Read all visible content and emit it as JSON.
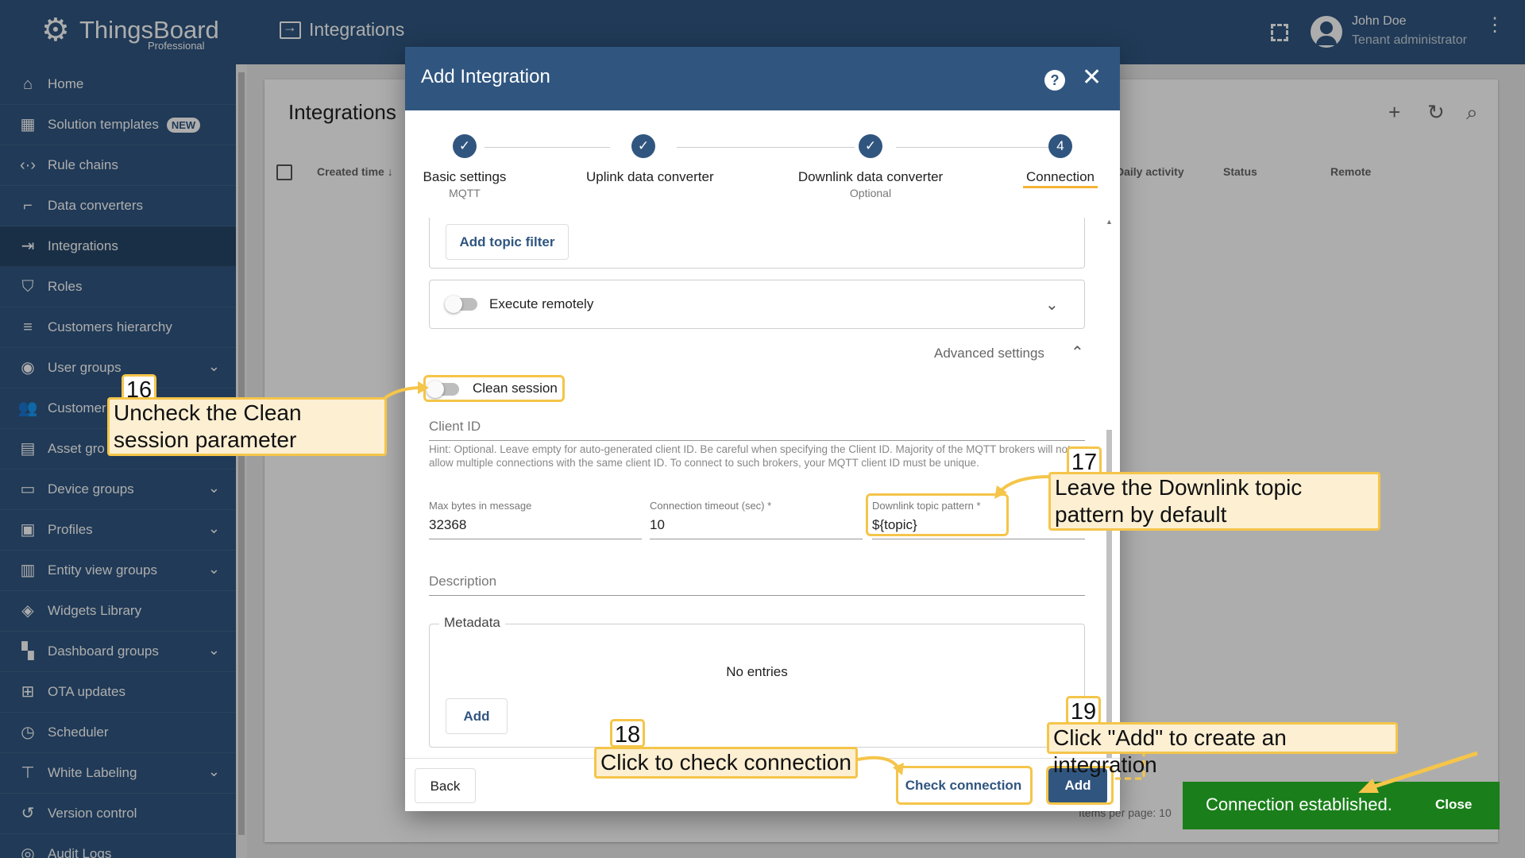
{
  "header": {
    "brand": "ThingsBoard",
    "brand_sub": "Professional",
    "page_title": "Integrations",
    "user_name": "John Doe",
    "user_role": "Tenant administrator"
  },
  "sidebar": {
    "items": [
      {
        "label": "Home",
        "icon": "home-icon"
      },
      {
        "label": "Solution templates",
        "icon": "grid-icon",
        "badge": "NEW"
      },
      {
        "label": "Rule chains",
        "icon": "code-icon"
      },
      {
        "label": "Data converters",
        "icon": "transform-icon"
      },
      {
        "label": "Integrations",
        "icon": "input-icon",
        "active": true
      },
      {
        "label": "Roles",
        "icon": "shield-icon"
      },
      {
        "label": "Customers hierarchy",
        "icon": "sort-icon"
      },
      {
        "label": "User groups",
        "icon": "account-circle-icon",
        "expandable": true
      },
      {
        "label": "Customer",
        "icon": "people-icon"
      },
      {
        "label": "Asset gro",
        "icon": "domain-icon"
      },
      {
        "label": "Device groups",
        "icon": "devices-icon",
        "expandable": true
      },
      {
        "label": "Profiles",
        "icon": "badge-icon",
        "expandable": true
      },
      {
        "label": "Entity view groups",
        "icon": "view-quilt-icon",
        "expandable": true
      },
      {
        "label": "Widgets Library",
        "icon": "widgets-icon"
      },
      {
        "label": "Dashboard groups",
        "icon": "dashboard-icon",
        "expandable": true
      },
      {
        "label": "OTA updates",
        "icon": "memory-icon"
      },
      {
        "label": "Scheduler",
        "icon": "clock-icon"
      },
      {
        "label": "White Labeling",
        "icon": "format-paint-icon",
        "expandable": true
      },
      {
        "label": "Version control",
        "icon": "history-icon"
      },
      {
        "label": "Audit Logs",
        "icon": "track-changes-icon"
      }
    ]
  },
  "content": {
    "title": "Integrations",
    "columns": [
      "Created time",
      "Daily activity",
      "Status",
      "Remote"
    ],
    "items_per_page_label": "Items per page:",
    "items_per_page_value": "10"
  },
  "dialog": {
    "title": "Add Integration",
    "steps": [
      {
        "label": "Basic settings",
        "sub": "MQTT",
        "state": "done"
      },
      {
        "label": "Uplink data converter",
        "sub": "",
        "state": "done"
      },
      {
        "label": "Downlink data converter",
        "sub": "Optional",
        "state": "done"
      },
      {
        "label": "Connection",
        "sub": "",
        "state": "active",
        "number": "4"
      }
    ],
    "add_topic_filter": "Add topic filter",
    "execute_remotely": "Execute remotely",
    "advanced_settings": "Advanced settings",
    "clean_session": "Clean session",
    "client_id_label": "Client ID",
    "client_id_hint": "Hint: Optional. Leave empty for auto-generated client ID. Be careful when specifying the Client ID. Majority of the MQTT brokers will not allow multiple connections with the same client ID. To connect to such brokers, your MQTT client ID must be unique.",
    "max_bytes_label": "Max bytes in message",
    "max_bytes_value": "32368",
    "timeout_label": "Connection timeout (sec) *",
    "timeout_value": "10",
    "downlink_label": "Downlink topic pattern *",
    "downlink_value": "${topic}",
    "description_label": "Description",
    "metadata_label": "Metadata",
    "no_entries": "No entries",
    "metadata_add": "Add",
    "back": "Back",
    "check_connection": "Check connection",
    "add": "Add"
  },
  "annotations": [
    {
      "number": "16",
      "text": "Uncheck the Clean session parameter"
    },
    {
      "number": "17",
      "text": "Leave the Downlink topic pattern by default"
    },
    {
      "number": "18",
      "text": "Click to check connection"
    },
    {
      "number": "19",
      "text": "Click \"Add\" to create an integration"
    }
  ],
  "toast": {
    "message": "Connection established.",
    "close": "Close"
  },
  "colors": {
    "primary": "#305680",
    "accent_highlight": "#f5c54a",
    "callout_bg": "#fcefd2",
    "toast_bg": "#1a7f1a"
  }
}
